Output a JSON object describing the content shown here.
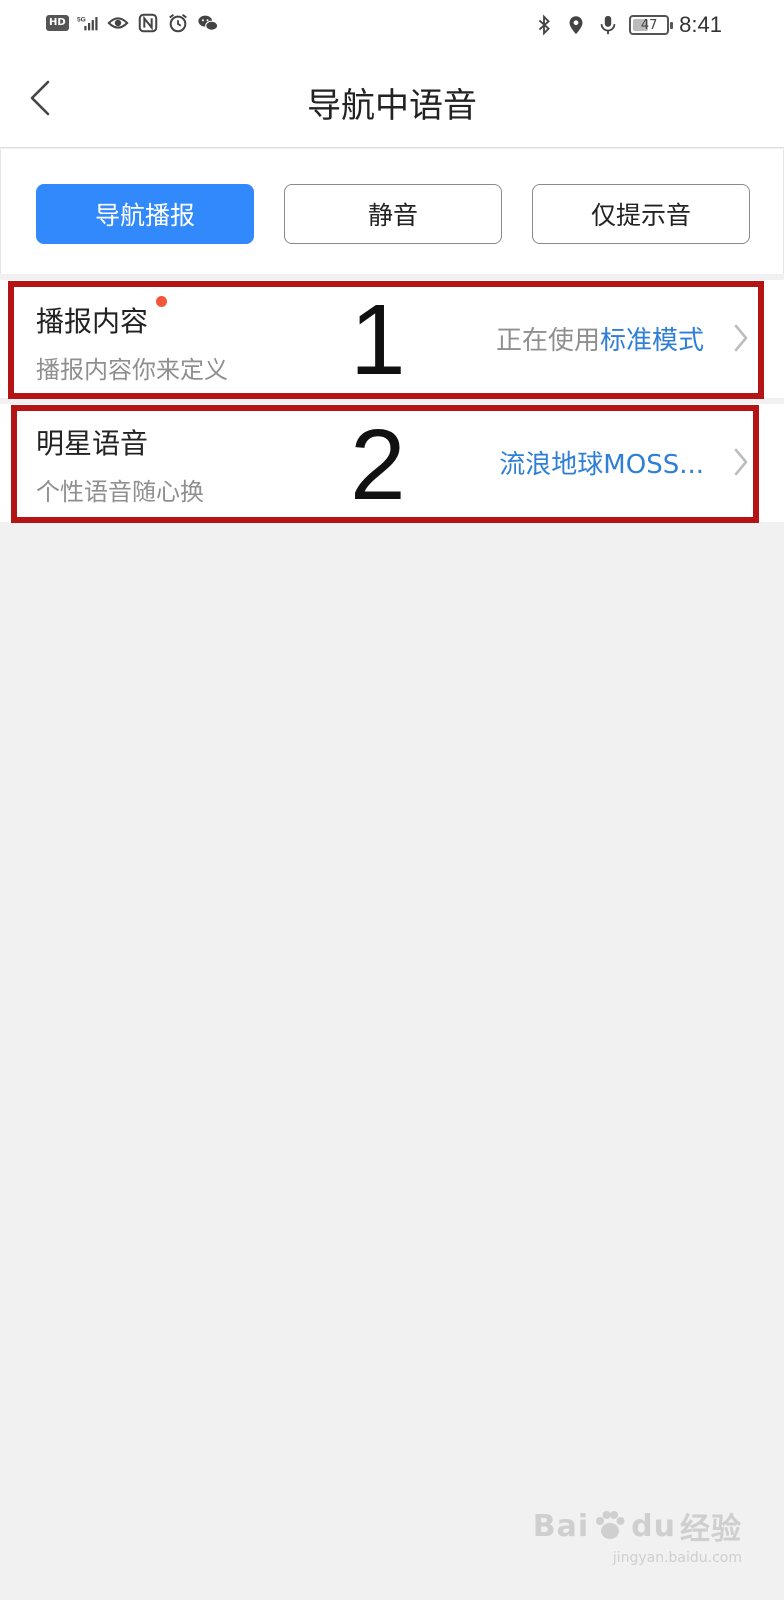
{
  "status_bar": {
    "hd": "HD",
    "network": "5G",
    "battery_level": "47",
    "time": "8:41"
  },
  "header": {
    "title": "导航中语音"
  },
  "modes": {
    "items": [
      {
        "label": "导航播报",
        "active": true
      },
      {
        "label": "静音",
        "active": false
      },
      {
        "label": "仅提示音",
        "active": false
      }
    ]
  },
  "rows": [
    {
      "title": "播报内容",
      "subtitle": "播报内容你来定义",
      "value_prefix": "正在使用",
      "value": "标准模式",
      "has_red_dot": true,
      "annotation": "1"
    },
    {
      "title": "明星语音",
      "subtitle": "个性语音随心换",
      "value_prefix": "",
      "value": "流浪地球MOSS...",
      "has_red_dot": false,
      "annotation": "2"
    }
  ],
  "watermark": {
    "brand": "Bai",
    "brand_suffix": "du",
    "product": "经验",
    "url": "jingyan.baidu.com"
  },
  "colors": {
    "accent": "#3289fb",
    "link": "#2f7fd6",
    "annotation": "#b51414",
    "red_dot": "#f2573a"
  }
}
